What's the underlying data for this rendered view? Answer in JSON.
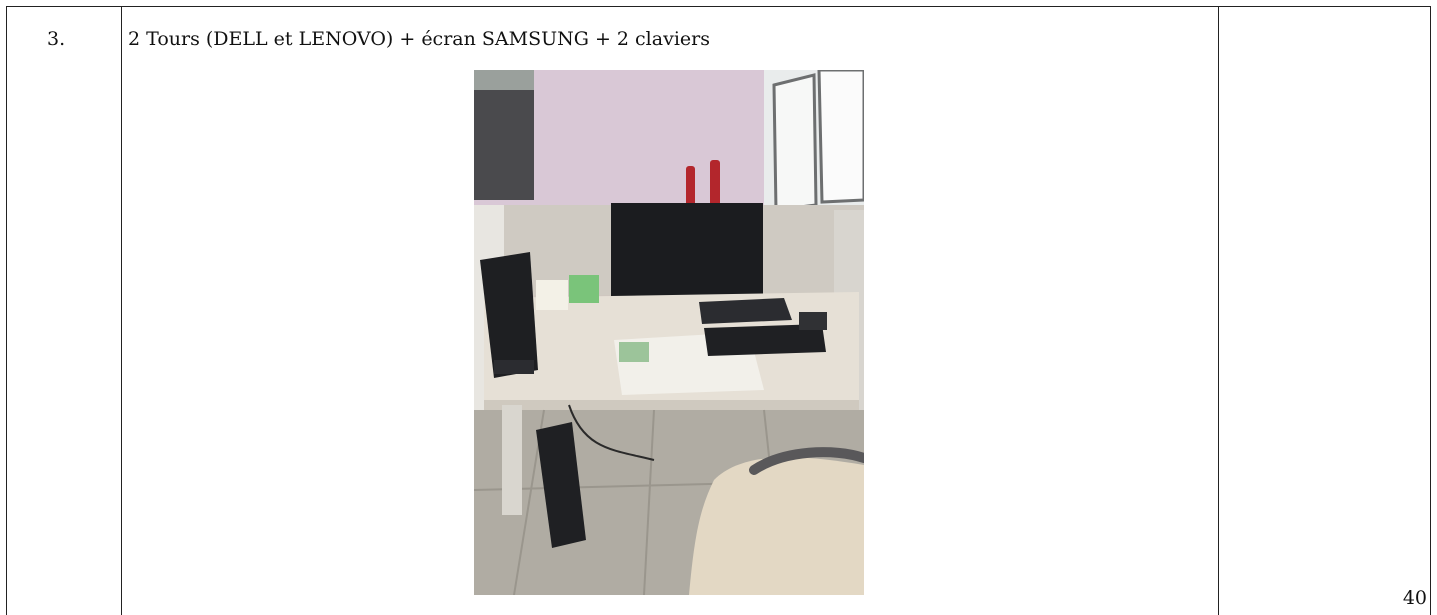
{
  "table": {
    "row_number": "3.",
    "description": "2 Tours (DELL et LENOVO) + écran SAMSUNG + 2 claviers"
  },
  "photo": {
    "icon": "office-desk-photo",
    "colors": {
      "wall": "#d9c8d6",
      "floor": "#a9a59c",
      "desk": "#e6e0d6",
      "partition": "#cfcac2",
      "monitor": "#1b1c1f",
      "extinguisher": "#b3262c",
      "chair": "#e3d8c4"
    }
  },
  "footer": {
    "page_number": "40"
  }
}
